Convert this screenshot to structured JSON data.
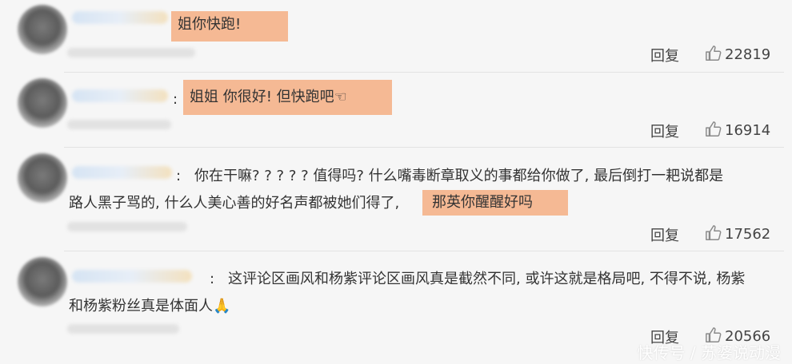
{
  "comments": [
    {
      "text_lines": [],
      "highlight": "姐你快跑!",
      "reply_label": "回复",
      "likes": "22819"
    },
    {
      "text_lines": [],
      "highlight": "姐姐 你很好! 但快跑吧☜",
      "reply_label": "回复",
      "likes": "16914"
    },
    {
      "text_lines": [
        "你在干嘛? ? ? ? ? 值得吗? 什么嘴毒断章取义的事都给你做了, 最后倒打一耙说都是",
        "路人黑子骂的, 什么人美心善的好名声都被她们得了,"
      ],
      "highlight": "那英你醒醒好吗",
      "reply_label": "回复",
      "likes": "17562"
    },
    {
      "text_lines": [
        "这评论区画风和杨紫评论区画风真是截然不同, 或许这就是格局吧, 不得不说, 杨紫",
        "和杨紫粉丝真是体面人🙏"
      ],
      "highlight": "",
      "reply_label": "回复",
      "likes": "20566"
    }
  ],
  "colon": ":",
  "watermark": "快传号 / 苏婆说动漫",
  "icons": {
    "like": "thumbs-up-icon"
  },
  "colors": {
    "highlight": "#f5b994",
    "background": "#f6f6f6"
  }
}
